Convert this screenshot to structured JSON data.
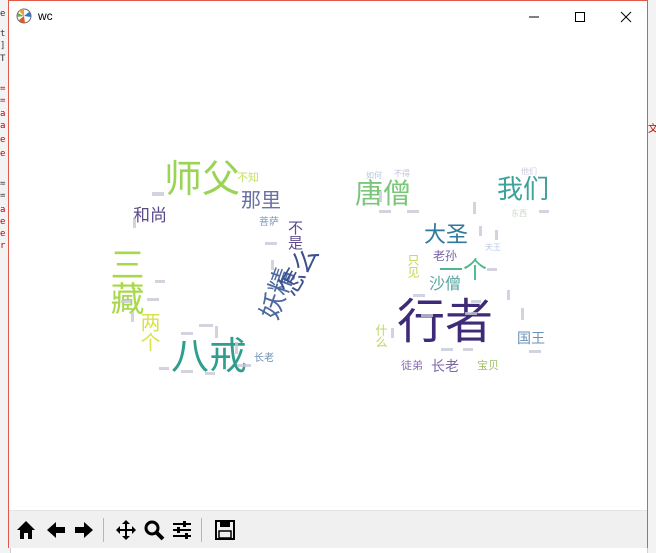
{
  "window": {
    "title": "wc",
    "accent": "#e05a4a"
  },
  "background_editor": {
    "fragments": [
      "e",
      "t",
      "]",
      "T",
      "=",
      "=",
      "a",
      "a",
      "e",
      "e",
      "=",
      "=",
      "a",
      "e",
      "e",
      "r"
    ],
    "right_fragment": "文"
  },
  "wordcloud": {
    "words": [
      {
        "text": "师父",
        "color": "#9ad454"
      },
      {
        "text": "八戒",
        "color": "#2f9e8d"
      },
      {
        "text": "三藏",
        "color": "#a8d94a"
      },
      {
        "text": "妖精",
        "color": "#4d6aa0"
      },
      {
        "text": "怎么",
        "color": "#3c4f8f"
      },
      {
        "text": "那里",
        "color": "#6b6fa3"
      },
      {
        "text": "和尚",
        "color": "#5a4a8a"
      },
      {
        "text": "不知",
        "color": "#c6e06a"
      },
      {
        "text": "两个",
        "color": "#d8e34c"
      },
      {
        "text": "不是",
        "color": "#5d4c8f"
      },
      {
        "text": "菩萨",
        "color": "#7e9ab7"
      },
      {
        "text": "长老",
        "color": "#6f8fb0"
      },
      {
        "text": "行者",
        "color": "#3f2a78"
      },
      {
        "text": "唐僧",
        "color": "#7bc77a"
      },
      {
        "text": "我们",
        "color": "#3da29a"
      },
      {
        "text": "大圣",
        "color": "#2f7a9a"
      },
      {
        "text": "一个",
        "color": "#4bb88d"
      },
      {
        "text": "沙僧",
        "color": "#58a6a0"
      },
      {
        "text": "老孙",
        "color": "#7a64a3"
      },
      {
        "text": "国王",
        "color": "#6a90b8"
      },
      {
        "text": "长老",
        "color": "#7c6aa8"
      },
      {
        "text": "只见",
        "color": "#c7d44e"
      },
      {
        "text": "徒弟",
        "color": "#8a6fb0"
      },
      {
        "text": "什么",
        "color": "#b8d660"
      },
      {
        "text": "宝贝",
        "color": "#9fbf6a"
      },
      {
        "text": "如何",
        "color": "#b6c7d8"
      },
      {
        "text": "不得",
        "color": "#c0c0d8"
      },
      {
        "text": "他们",
        "color": "#d0c8e0"
      },
      {
        "text": "东西",
        "color": "#c8d8c8"
      },
      {
        "text": "天王",
        "color": "#b8c8e0"
      }
    ]
  },
  "toolbar": {
    "buttons": [
      "home",
      "back",
      "forward",
      "pan",
      "zoom",
      "configure-subplots",
      "save"
    ]
  }
}
